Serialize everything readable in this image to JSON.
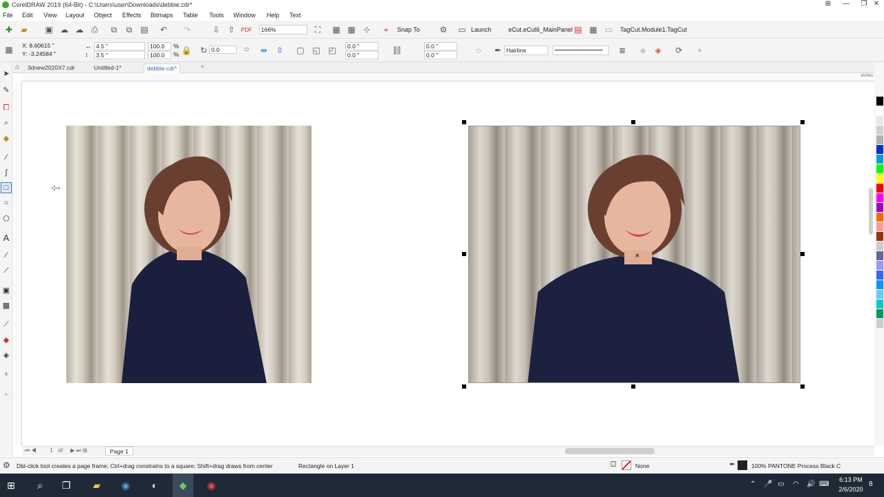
{
  "window": {
    "title": "CorelDRAW 2019 (64-Bit) - C:\\Users\\user\\Downloads\\debbie.cdr*"
  },
  "menu": [
    "File",
    "Edit",
    "View",
    "Layout",
    "Object",
    "Effects",
    "Bitmaps",
    "Table",
    "Tools",
    "Window",
    "Help",
    "Text"
  ],
  "standard_toolbar": {
    "zoom": "166%",
    "snap_to": "Snap To",
    "launch": "Launch",
    "ecut_panel": "eCut.eCut6_MainPanel",
    "tagcut": "TagCut.Module1.TagCut"
  },
  "property_bar": {
    "x": "X:  8.60615 \"",
    "y": "Y:  -3.24584 \"",
    "width": "4.5 \"",
    "height": "3.5 \"",
    "scale_w": "100.0",
    "scale_h": "100.0",
    "percent": "%",
    "rotation": "0.0",
    "corner1": "0.0 \"",
    "corner2": "0.0 \"",
    "corner3": "0.0 \"",
    "corner4": "0.0 \"",
    "outline": "Hairline"
  },
  "doc_tabs": [
    {
      "label": "3dnew2020X7.cdr"
    },
    {
      "label": "Untitled-1*"
    },
    {
      "label": "debbie.cdr*"
    }
  ],
  "ruler": {
    "units": "inches"
  },
  "page_nav": {
    "count": "1",
    "of": "of",
    "page_tab": "Page 1"
  },
  "status": {
    "hint": "Dbl-click tool creates a page frame; Ctrl+drag constrains to a square; Shift+drag draws from center",
    "object": "Rectangle on Layer 1",
    "fill": "None",
    "outline": "100% PANTONE Process Black C"
  },
  "taskbar": {
    "time": "6:13 PM",
    "date": "2/6/2020",
    "notifications": "8"
  },
  "palette": [
    "#000000",
    "#ffffff",
    "#e8e8e8",
    "#d0d0d0",
    "#b0b0b0",
    "#0033cc",
    "#00a0e0",
    "#00ff00",
    "#ffff00",
    "#ff0000",
    "#ff00ff",
    "#9900cc",
    "#ff6600",
    "#ff9999",
    "#993300",
    "#cccccc",
    "#666699",
    "#9999ff",
    "#3366ff",
    "#0099ff",
    "#66ccff",
    "#00cccc",
    "#009966",
    "#cccccc"
  ],
  "colors": {
    "accent": "#2a6fb0",
    "taskbar": "#1f2a36"
  }
}
